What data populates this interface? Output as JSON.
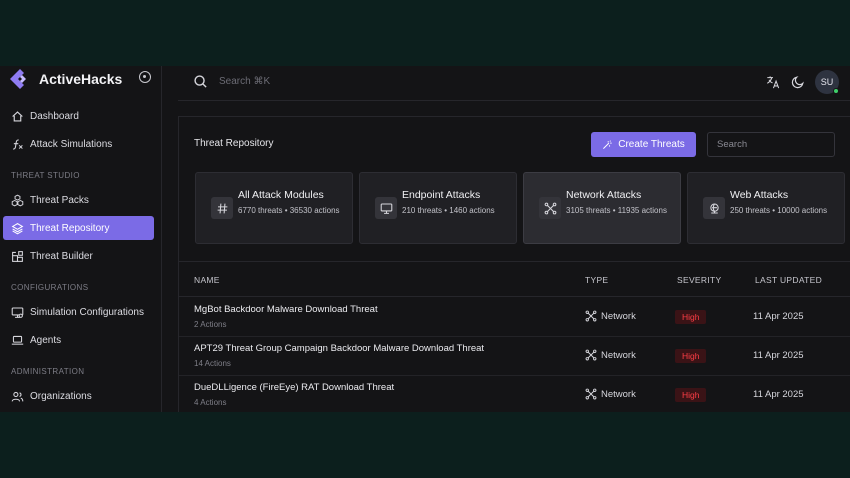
{
  "brand": {
    "name": "ActiveHacks"
  },
  "sidebar": {
    "items": [
      {
        "label": "Dashboard",
        "icon": "home-icon"
      },
      {
        "label": "Attack Simulations",
        "icon": "function-icon"
      }
    ],
    "sections": [
      {
        "title": "THREAT STUDIO",
        "items": [
          {
            "label": "Threat Packs",
            "icon": "cubes-icon"
          },
          {
            "label": "Threat Repository",
            "icon": "layers-icon",
            "active": true
          },
          {
            "label": "Threat Builder",
            "icon": "blocks-icon"
          }
        ]
      },
      {
        "title": "CONFIGURATIONS",
        "items": [
          {
            "label": "Simulation Configurations",
            "icon": "monitor-gear-icon"
          },
          {
            "label": "Agents",
            "icon": "laptop-icon"
          }
        ]
      },
      {
        "title": "ADMINISTRATION",
        "items": [
          {
            "label": "Organizations",
            "icon": "users-icon"
          }
        ]
      }
    ]
  },
  "topbar": {
    "search_placeholder": "Search ⌘K",
    "avatar_initials": "SU"
  },
  "main": {
    "title": "Threat Repository",
    "create_button": "Create Threats",
    "search_placeholder": "Search",
    "cards": [
      {
        "title": "All Attack Modules",
        "subtitle": "6770 threats • 36530 actions",
        "icon": "hash-icon",
        "selected": false
      },
      {
        "title": "Endpoint Attacks",
        "subtitle": "210 threats • 1460 actions",
        "icon": "monitor-icon",
        "selected": false
      },
      {
        "title": "Network Attacks",
        "subtitle": "3105 threats • 11935 actions",
        "icon": "network-icon",
        "selected": true
      },
      {
        "title": "Web Attacks",
        "subtitle": "250 threats • 10000 actions",
        "icon": "globe-icon",
        "selected": false
      }
    ],
    "table": {
      "columns": [
        "NAME",
        "TYPE",
        "SEVERITY",
        "LAST UPDATED"
      ],
      "rows": [
        {
          "name": "MgBot Backdoor Malware Download Threat",
          "actions": "2 Actions",
          "type": "Network",
          "severity": "High",
          "updated": "11 Apr 2025"
        },
        {
          "name": "APT29 Threat Group Campaign Backdoor Malware Download Threat",
          "actions": "14 Actions",
          "type": "Network",
          "severity": "High",
          "updated": "11 Apr 2025"
        },
        {
          "name": "DueDLLigence (FireEye) RAT Download Threat",
          "actions": "4 Actions",
          "type": "Network",
          "severity": "High",
          "updated": "11 Apr 2025"
        }
      ]
    }
  },
  "colors": {
    "accent": "#7b6be6",
    "severity_high": "#ff3d45",
    "background": "#141416",
    "outer": "#0c1f1d"
  }
}
